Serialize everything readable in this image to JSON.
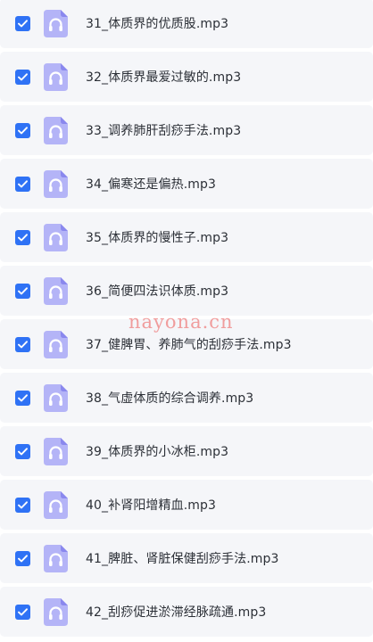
{
  "files": [
    {
      "name": "31_体质界的优质股.mp3",
      "checked": true
    },
    {
      "name": "32_体质界最爱过敏的.mp3",
      "checked": true
    },
    {
      "name": "33_调养肺肝刮痧手法.mp3",
      "checked": true
    },
    {
      "name": "34_偏寒还是偏热.mp3",
      "checked": true
    },
    {
      "name": "35_体质界的慢性子.mp3",
      "checked": true
    },
    {
      "name": "36_简便四法识体质.mp3",
      "checked": true
    },
    {
      "name": "37_健脾胃、养肺气的刮痧手法.mp3",
      "checked": true
    },
    {
      "name": "38_气虚体质的综合调养.mp3",
      "checked": true
    },
    {
      "name": "39_体质界的小冰柜.mp3",
      "checked": true
    },
    {
      "name": "40_补肾阳增精血.mp3",
      "checked": true
    },
    {
      "name": "41_脾脏、肾脏保健刮痧手法.mp3",
      "checked": true
    },
    {
      "name": "42_刮痧促进淤滞经脉疏通.mp3",
      "checked": true
    }
  ],
  "file_icon": "headphones-audio-file-icon",
  "checkbox_icon": "checkmark-icon",
  "watermark": "nayona.cn",
  "colors": {
    "checkbox": "#2f72f5",
    "file_icon_light": "#b4b4f7",
    "file_icon_dark": "#8a88ee",
    "row_background": "#f5f6f9",
    "watermark": "#f08e8e"
  }
}
